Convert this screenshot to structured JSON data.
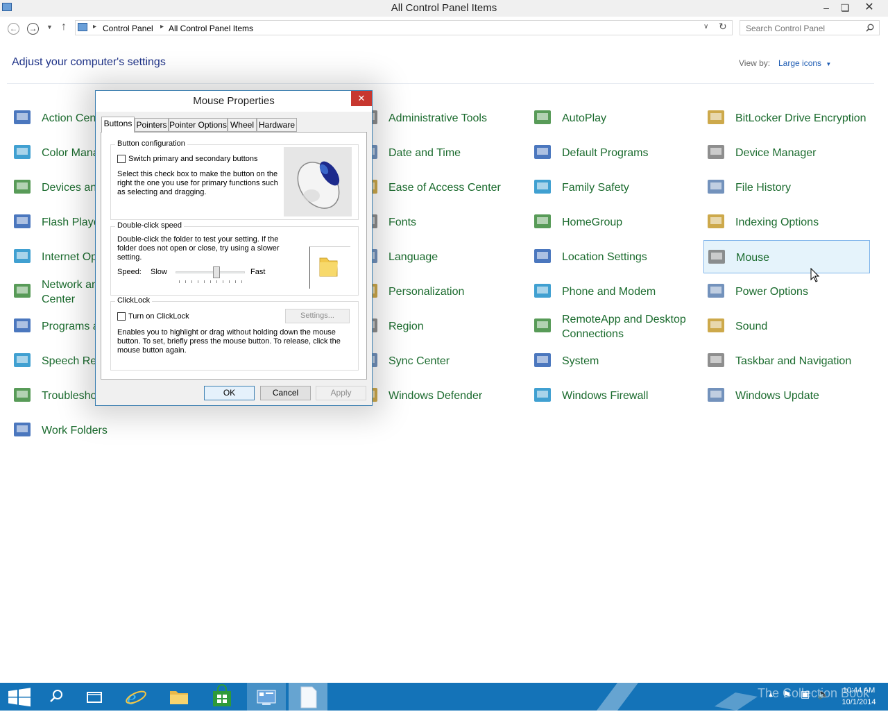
{
  "window": {
    "title": "All Control Panel Items"
  },
  "address": {
    "breadcrumbs": [
      "Control Panel",
      "All Control Panel Items"
    ],
    "search_placeholder": "Search Control Panel"
  },
  "header": {
    "title": "Adjust your computer's settings",
    "view_by_label": "View by:",
    "view_by_value": "Large icons"
  },
  "items": [
    {
      "label": "Action Center",
      "icon": "flag-icon"
    },
    {
      "label": "Administrative Tools",
      "icon": "admin-tools-icon"
    },
    {
      "label": "AutoPlay",
      "icon": "autoplay-icon"
    },
    {
      "label": "BitLocker Drive Encryption",
      "icon": "bitlocker-icon"
    },
    {
      "label": "Color Management",
      "icon": "color-icon"
    },
    {
      "label": "Date and Time",
      "icon": "clock-icon"
    },
    {
      "label": "Default Programs",
      "icon": "default-programs-icon"
    },
    {
      "label": "Device Manager",
      "icon": "device-manager-icon"
    },
    {
      "label": "Devices and Printers",
      "icon": "printer-icon"
    },
    {
      "label": "Ease of Access Center",
      "icon": "ease-of-access-icon"
    },
    {
      "label": "Family Safety",
      "icon": "family-icon"
    },
    {
      "label": "File History",
      "icon": "file-history-icon"
    },
    {
      "label": "Flash Player",
      "icon": "flash-icon"
    },
    {
      "label": "Fonts",
      "icon": "fonts-icon"
    },
    {
      "label": "HomeGroup",
      "icon": "homegroup-icon"
    },
    {
      "label": "Indexing Options",
      "icon": "indexing-icon"
    },
    {
      "label": "Internet Options",
      "icon": "internet-icon"
    },
    {
      "label": "Language",
      "icon": "language-icon"
    },
    {
      "label": "Location Settings",
      "icon": "location-icon"
    },
    {
      "label": "Mouse",
      "icon": "mouse-icon"
    },
    {
      "label": "Network and Sharing Center",
      "icon": "network-icon"
    },
    {
      "label": "Personalization",
      "icon": "personalization-icon"
    },
    {
      "label": "Phone and Modem",
      "icon": "phone-icon"
    },
    {
      "label": "Power Options",
      "icon": "power-icon"
    },
    {
      "label": "Programs and Features",
      "icon": "programs-icon"
    },
    {
      "label": "Region",
      "icon": "region-icon"
    },
    {
      "label": "RemoteApp and Desktop Connections",
      "icon": "remoteapp-icon"
    },
    {
      "label": "Sound",
      "icon": "sound-icon"
    },
    {
      "label": "Speech Recognition",
      "icon": "microphone-icon"
    },
    {
      "label": "Sync Center",
      "icon": "sync-icon"
    },
    {
      "label": "System",
      "icon": "system-icon"
    },
    {
      "label": "Taskbar and Navigation",
      "icon": "taskbar-icon"
    },
    {
      "label": "Troubleshooting",
      "icon": "troubleshoot-icon"
    },
    {
      "label": "Windows Defender",
      "icon": "defender-icon"
    },
    {
      "label": "Windows Firewall",
      "icon": "firewall-icon"
    },
    {
      "label": "Windows Update",
      "icon": "update-icon"
    },
    {
      "label": "Work Folders",
      "icon": "folder-icon"
    }
  ],
  "dialog": {
    "title": "Mouse Properties",
    "tabs": [
      "Buttons",
      "Pointers",
      "Pointer Options",
      "Wheel",
      "Hardware"
    ],
    "active_tab": "Buttons",
    "button_config": {
      "title": "Button configuration",
      "checkbox_label": "Switch primary and secondary buttons",
      "checked": false,
      "description": "Select this check box to make the button on the right the one you use for primary functions such as selecting and dragging."
    },
    "double_click": {
      "title": "Double-click speed",
      "description": "Double-click the folder to test your setting. If the folder does not open or close, try using a slower setting.",
      "speed_label": "Speed:",
      "slow_label": "Slow",
      "fast_label": "Fast",
      "slider_value": 0.6
    },
    "clicklock": {
      "title": "ClickLock",
      "checkbox_label": "Turn on ClickLock",
      "checked": false,
      "settings_label": "Settings...",
      "description": "Enables you to highlight or drag without holding down the mouse button. To set, briefly press the mouse button. To release, click the mouse button again."
    },
    "buttons": {
      "ok": "OK",
      "cancel": "Cancel",
      "apply": "Apply"
    }
  },
  "taskbar": {
    "time": "10:44 AM",
    "date": "10/1/2014",
    "watermark": "The Collection Book"
  },
  "colors": {
    "link_green": "#1b6b2e",
    "title_blue": "#1e3287",
    "taskbar": "#1473b8",
    "selection": "#e5f3fb"
  }
}
